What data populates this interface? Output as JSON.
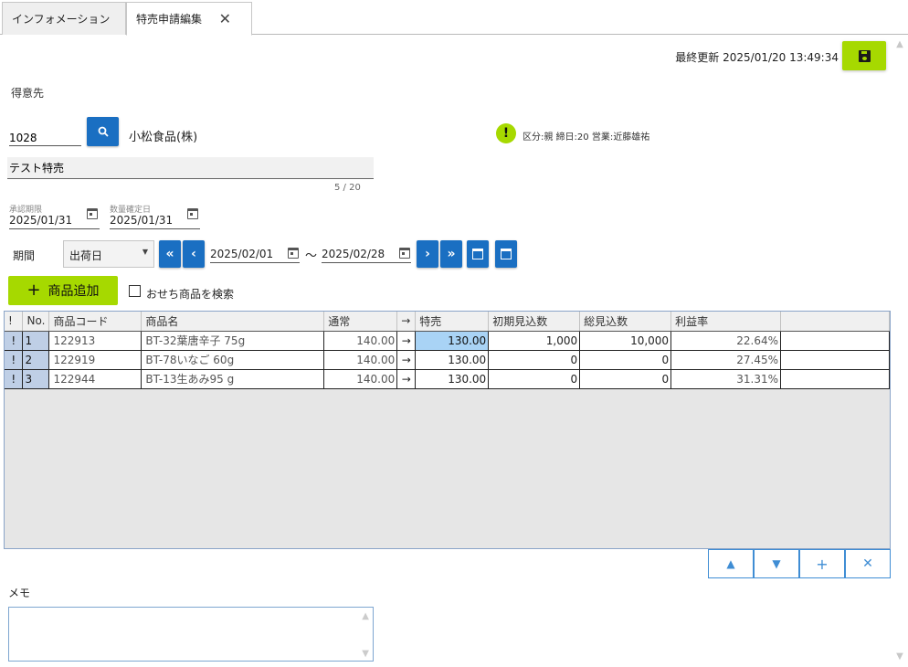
{
  "tabs": [
    {
      "label": "インフォメーション"
    },
    {
      "label": "特売申請編集"
    }
  ],
  "header": {
    "last_updated_label": "最終更新",
    "last_updated_value": "2025/01/20 13:49:34"
  },
  "customer": {
    "label": "得意先",
    "code": "1028",
    "name": "小松食品(株)",
    "info": "区分:親 締日:20 営業:近藤雄祐"
  },
  "title": {
    "value": "テスト特売",
    "char_count": "5 / 20"
  },
  "dates": {
    "approval_label": "承認期限",
    "approval_value": "2025/01/31",
    "quantity_label": "数量確定日",
    "quantity_value": "2025/01/31"
  },
  "period": {
    "label": "期間",
    "type_selected": "出荷日",
    "from": "2025/02/01",
    "tilde": "～",
    "to": "2025/02/28"
  },
  "actions": {
    "add_product": "商品追加",
    "osechi_search": "おせち商品を検索"
  },
  "table": {
    "columns": [
      "!",
      "No.",
      "商品コード",
      "商品名",
      "通常",
      "→",
      "特売",
      "初期見込数",
      "総見込数",
      "利益率",
      ""
    ],
    "rows": [
      {
        "excl": "!",
        "no": "1",
        "code": "122913",
        "name": "BT-32葉唐辛子 75g",
        "normal": "140.00",
        "arrow": "→",
        "special": "130.00",
        "initial": "1,000",
        "total": "10,000",
        "margin": "22.64%"
      },
      {
        "excl": "!",
        "no": "2",
        "code": "122919",
        "name": "BT-78いなご 60g",
        "normal": "140.00",
        "arrow": "→",
        "special": "130.00",
        "initial": "0",
        "total": "0",
        "margin": "27.45%"
      },
      {
        "excl": "!",
        "no": "3",
        "code": "122944",
        "name": "BT-13生あみ95 g",
        "normal": "140.00",
        "arrow": "→",
        "special": "130.00",
        "initial": "0",
        "total": "0",
        "margin": "31.31%"
      }
    ]
  },
  "memo": {
    "label": "メモ",
    "value": ""
  },
  "colors": {
    "accent_green": "#a6d900",
    "primary_blue": "#1a6fc2"
  }
}
